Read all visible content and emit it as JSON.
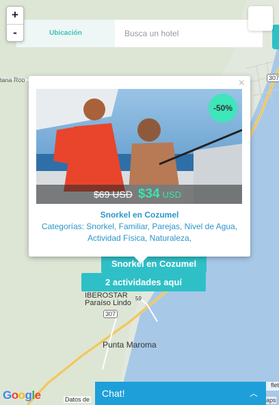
{
  "zoom": {
    "in_label": "+",
    "out_label": "-"
  },
  "search": {
    "location_label": "Ubicación",
    "placeholder": "Busca un hotel"
  },
  "popup": {
    "close_label": "×",
    "discount": "-50%",
    "old_price": "$69 USD",
    "new_price": "$34",
    "currency": "USD",
    "title": "Snorkel en Cozumel",
    "categories": "Categorías: Snorkel, Familiar, Parejas, Nivel de Agua, Actividad Física, Naturaleza,"
  },
  "markers": {
    "activity_label": "Snorkel en Cozumel",
    "cluster_label": "2 actividades aquí"
  },
  "map_labels": {
    "quintana_roo": "tana Roo",
    "highway_307_top": "307",
    "highway_307_bottom": "307",
    "highway_59": "59",
    "iberostar": "IBEROSTAR",
    "paraiso_lindo": "Paraíso Lindo",
    "punta_maroma": "Punta Maroma"
  },
  "footer": {
    "google_logo": "Google",
    "map_data": "Datos de",
    "leaflet": "flet",
    "maps": "aps",
    "chat_label": "Chat!",
    "chat_icon": "chevron-up-icon"
  },
  "colors": {
    "accent": "#2fc0c7",
    "price": "#3be3b0",
    "link": "#2a95c9",
    "chat": "#1e9fd9",
    "water": "#a8c8e8"
  }
}
